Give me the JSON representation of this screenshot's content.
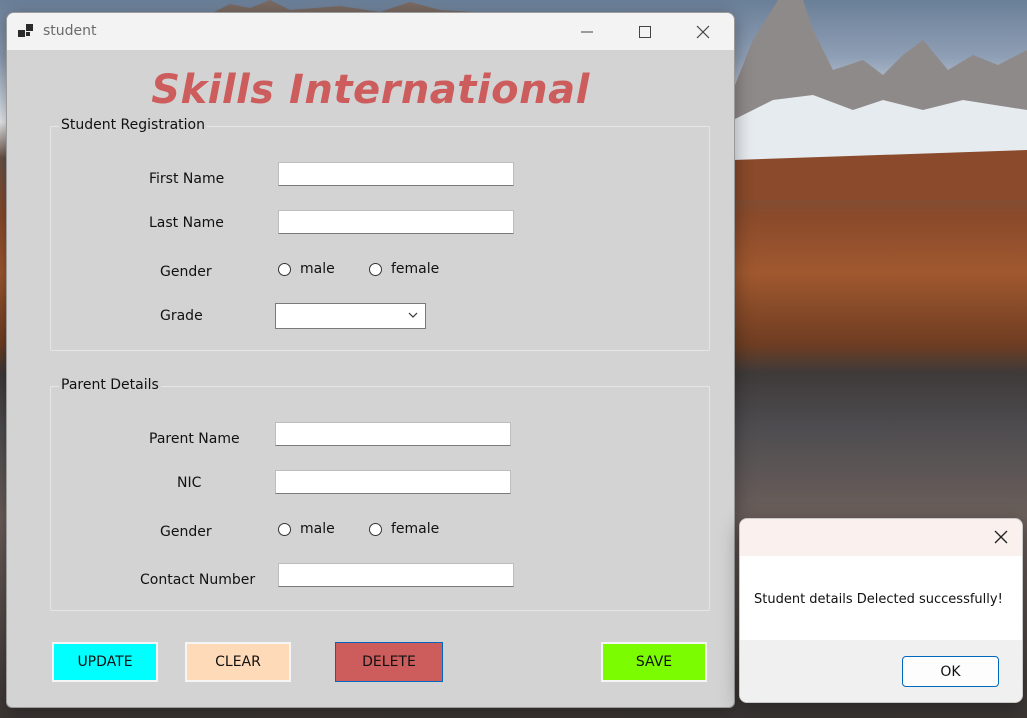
{
  "window": {
    "title": "student",
    "brand": "Skills International"
  },
  "student_section": {
    "legend": "Student Registration",
    "first_name_label": "First Name",
    "first_name_value": "",
    "last_name_label": "Last Name",
    "last_name_value": "",
    "gender_label": "Gender",
    "gender_male": "male",
    "gender_female": "female",
    "grade_label": "Grade",
    "grade_value": ""
  },
  "parent_section": {
    "legend": "Parent Details",
    "parent_name_label": "Parent Name",
    "parent_name_value": "",
    "nic_label": "NIC",
    "nic_value": "",
    "gender_label": "Gender",
    "gender_male": "male",
    "gender_female": "female",
    "contact_label": "Contact Number",
    "contact_value": ""
  },
  "actions": {
    "update": "UPDATE",
    "clear": "CLEAR",
    "delete": "DELETE",
    "save": "SAVE"
  },
  "colors": {
    "brand": "#cd5c5c",
    "update_bg": "#00ffff",
    "clear_bg": "#ffdab9",
    "delete_bg": "#cd5c5c",
    "save_bg": "#7cfc00"
  },
  "dialog": {
    "message": "Student details Delected successfully!",
    "ok_label": "OK"
  }
}
